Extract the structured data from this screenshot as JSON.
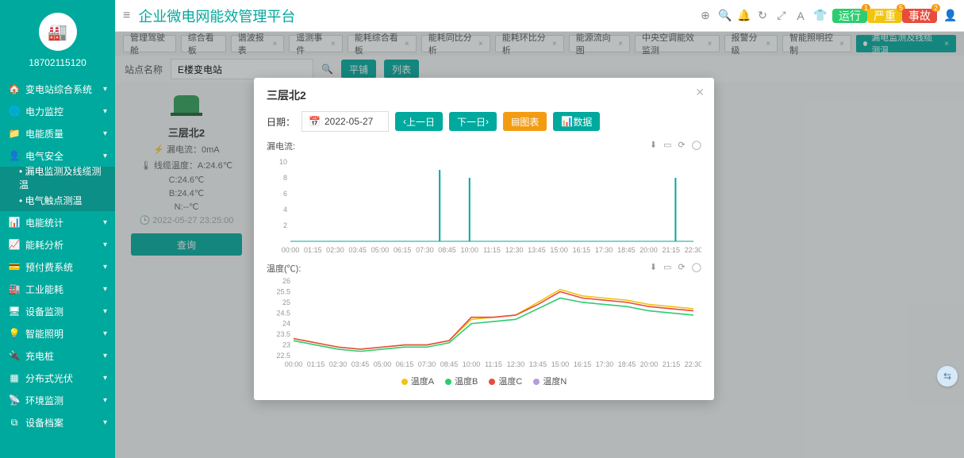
{
  "user_id": "18702115120",
  "app_title": "企业微电网能效管理平台",
  "sidebar": [
    {
      "icon": "🏠",
      "label": "变电站综合系统",
      "arrow": "▾"
    },
    {
      "icon": "🌐",
      "label": "电力监控",
      "arrow": "▾"
    },
    {
      "icon": "📁",
      "label": "电能质量",
      "arrow": "▾"
    },
    {
      "icon": "👤",
      "label": "电气安全",
      "arrow": "▴",
      "open": true
    },
    {
      "sub": true,
      "label": "漏电监测及线缆测温",
      "active": true
    },
    {
      "sub": true,
      "label": "电气触点测温"
    },
    {
      "icon": "📊",
      "label": "电能统计",
      "arrow": "▾"
    },
    {
      "icon": "📈",
      "label": "能耗分析",
      "arrow": "▾"
    },
    {
      "icon": "💳",
      "label": "预付费系统",
      "arrow": "▾"
    },
    {
      "icon": "🏭",
      "label": "工业能耗",
      "arrow": "▾"
    },
    {
      "icon": "🖥",
      "label": "设备监测",
      "arrow": "▾"
    },
    {
      "icon": "💡",
      "label": "智能照明",
      "arrow": "▾"
    },
    {
      "icon": "🔌",
      "label": "充电桩",
      "arrow": "▾"
    },
    {
      "icon": "▦",
      "label": "分布式光伏",
      "arrow": "▾"
    },
    {
      "icon": "📡",
      "label": "环境监测",
      "arrow": "▾"
    },
    {
      "icon": "⧉",
      "label": "设备档案",
      "arrow": "▾"
    }
  ],
  "tabs": [
    {
      "label": "管理驾驶舱"
    },
    {
      "label": "综合看板"
    },
    {
      "label": "谐波报表",
      "x": true
    },
    {
      "label": "遥测事件",
      "x": true
    },
    {
      "label": "能耗综合看板",
      "x": true
    },
    {
      "label": "能耗同比分析",
      "x": true
    },
    {
      "label": "能耗环比分析",
      "x": true
    },
    {
      "label": "能源流向图",
      "x": true
    },
    {
      "label": "中央空调能效监测",
      "x": true
    },
    {
      "label": "报警分级",
      "x": true
    },
    {
      "label": "智能照明控制",
      "x": true
    },
    {
      "label": "漏电监测及线缆测温",
      "x": true,
      "active": true
    }
  ],
  "filter": {
    "label": "站点名称",
    "value": "E楼变电站",
    "btn1": "平铺",
    "btn2": "列表"
  },
  "device": {
    "name": "三层北2",
    "leak_label": "漏电流：",
    "leak_value": "0mA",
    "temp_label": "线缆温度：",
    "tA": "A:24.6℃",
    "tC": "C:24.6℃",
    "tB": "B:24.4℃",
    "tN": "N:--℃",
    "time": "2022-05-27 23:25:00",
    "btn": "查询"
  },
  "modal": {
    "title": "三层北2",
    "date_label": "日期：",
    "date_value": "2022-05-27",
    "prev": "上一日",
    "next": "下一日",
    "chart_btn": "图表",
    "data_btn": "数据",
    "leak_title": "漏电流:",
    "temp_title": "温度(℃):",
    "legend": [
      "温度A",
      "温度B",
      "温度C",
      "温度N"
    ],
    "legend_colors": [
      "#f1c40f",
      "#2ecc71",
      "#e74c3c",
      "#b39ddb"
    ]
  },
  "badges": [
    {
      "cls": "green",
      "label": "运行",
      "sup": "1"
    },
    {
      "cls": "orange",
      "label": "严重",
      "sup": "5"
    },
    {
      "cls": "red",
      "label": "事故",
      "sup": "2"
    }
  ],
  "chart_data": {
    "x_ticks": [
      "00:00",
      "01:15",
      "02:30",
      "03:45",
      "05:00",
      "06:15",
      "07:30",
      "08:45",
      "10:00",
      "11:15",
      "12:30",
      "13:45",
      "15:00",
      "16:15",
      "17:30",
      "18:45",
      "20:00",
      "21:15",
      "22:30"
    ],
    "leak": {
      "type": "line",
      "ylim": [
        0,
        10
      ],
      "y_ticks": [
        2,
        4,
        6,
        8,
        10
      ],
      "spikes": [
        {
          "x": "08:20",
          "v": 9
        },
        {
          "x": "10:00",
          "v": 8
        },
        {
          "x": "21:30",
          "v": 8
        }
      ]
    },
    "temp": {
      "type": "line",
      "ylim": [
        22.5,
        26
      ],
      "y_ticks": [
        22.5,
        23,
        23.5,
        24,
        24.5,
        25,
        25.5,
        26
      ],
      "series": [
        {
          "name": "温度A",
          "color": "#f1c40f",
          "values": [
            23.3,
            23.1,
            22.9,
            22.8,
            22.9,
            23.0,
            23.0,
            23.2,
            24.2,
            24.3,
            24.4,
            25.0,
            25.6,
            25.3,
            25.2,
            25.1,
            24.9,
            24.8,
            24.7
          ]
        },
        {
          "name": "温度B",
          "color": "#2ecc71",
          "values": [
            23.2,
            23.0,
            22.8,
            22.7,
            22.8,
            22.9,
            22.9,
            23.1,
            24.0,
            24.1,
            24.2,
            24.7,
            25.2,
            25.0,
            24.9,
            24.8,
            24.6,
            24.5,
            24.4
          ]
        },
        {
          "name": "温度C",
          "color": "#e74c3c",
          "values": [
            23.3,
            23.1,
            22.9,
            22.8,
            22.9,
            23.0,
            23.0,
            23.2,
            24.3,
            24.3,
            24.4,
            24.9,
            25.5,
            25.2,
            25.1,
            25.0,
            24.8,
            24.7,
            24.6
          ]
        }
      ]
    }
  }
}
